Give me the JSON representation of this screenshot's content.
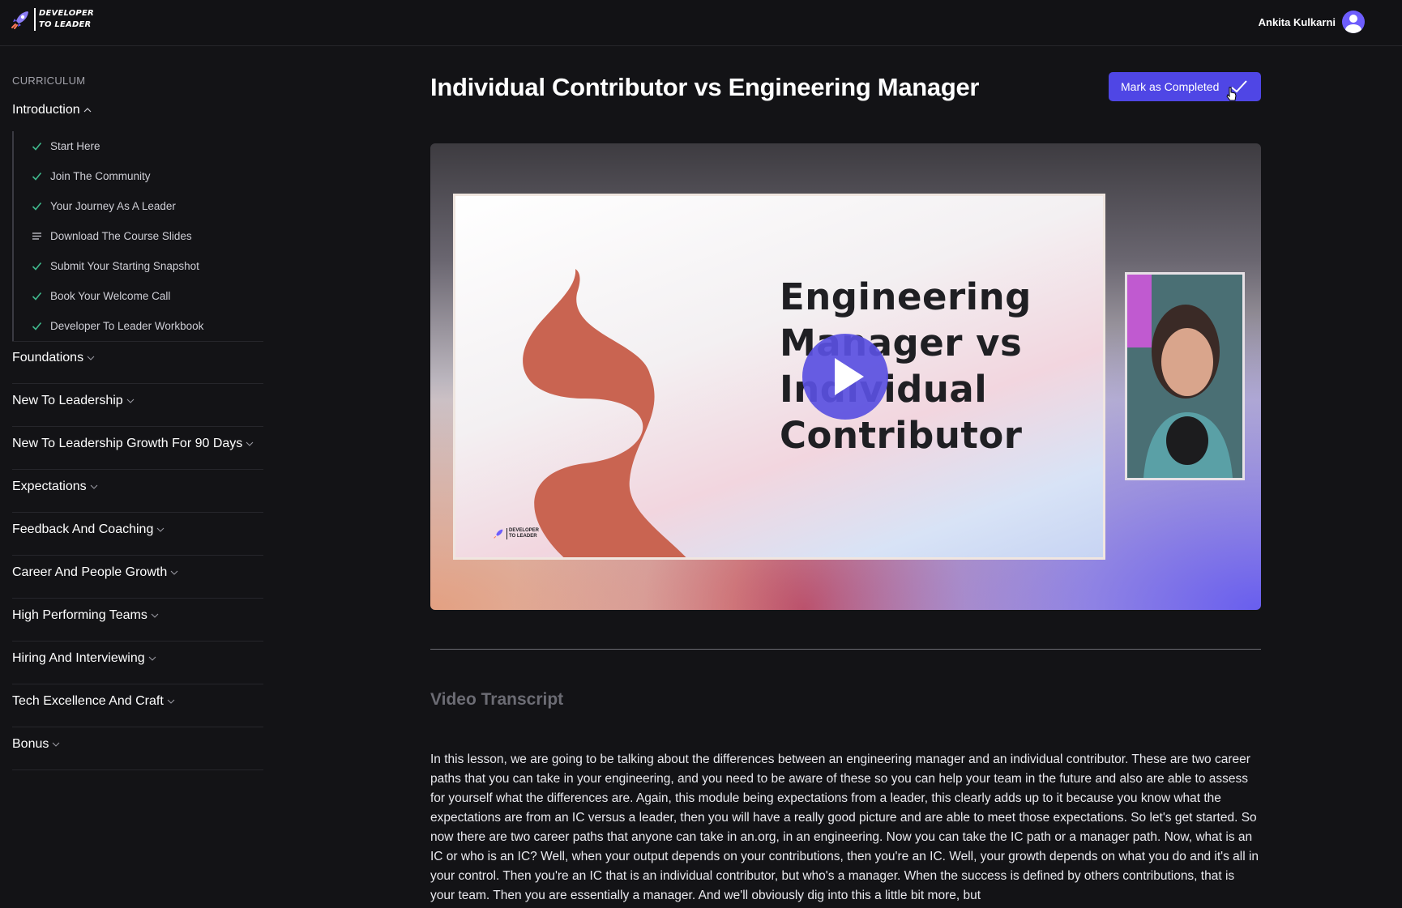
{
  "header": {
    "logo_line1": "DEVELOPER",
    "logo_line2": "TO LEADER",
    "user_name": "Ankita Kulkarni",
    "avatar_icon": "user-avatar-icon"
  },
  "sidebar": {
    "label": "CURRICULUM",
    "open_section": {
      "title": "Introduction",
      "lessons": [
        {
          "label": "Start Here",
          "icon": "check-icon"
        },
        {
          "label": "Join The Community",
          "icon": "check-icon"
        },
        {
          "label": "Your Journey As A Leader",
          "icon": "check-icon"
        },
        {
          "label": "Download The Course Slides",
          "icon": "lines-icon"
        },
        {
          "label": "Submit Your Starting Snapshot",
          "icon": "check-icon"
        },
        {
          "label": "Book Your Welcome Call",
          "icon": "check-icon"
        },
        {
          "label": "Developer To Leader Workbook",
          "icon": "check-icon"
        }
      ]
    },
    "sections": [
      "Foundations",
      "New To Leadership",
      "New To Leadership Growth For 90 Days",
      "Expectations",
      "Feedback And Coaching",
      "Career And People Growth",
      "High Performing Teams",
      "Hiring And Interviewing",
      "Tech Excellence And Craft",
      "Bonus"
    ]
  },
  "main": {
    "title": "Individual Contributor vs Engineering Manager",
    "mark_button": "Mark as Completed",
    "video": {
      "slide_title": [
        "Engineering",
        "Manager vs",
        "Individual",
        "Contributor"
      ],
      "slide_logo_line1": "DEVELOPER",
      "slide_logo_line2": "TO LEADER"
    },
    "transcript_title": "Video Transcript",
    "transcript": "In this lesson, we are going to be talking about the differences between an engineering manager and an individual contributor. These are two career paths that you can take in your engineering, and you need to be aware of these so you can help your team in the future and also are able to assess for yourself what the differences are. Again, this module being expectations from a leader, this clearly adds up to it because you know what the expectations are from an IC versus a leader, then you will have a really good picture and are able to meet those expectations. So let's get started. So now there are two career paths that anyone can take in an.org, in an engineering. Now you can take the IC path or a manager path. Now, what is an IC or who is an IC? Well, when your output depends on your contributions, then you're an IC. Well, your growth depends on what you do and it's all in your control. Then you're an IC that is an individual contributor, but who's a manager. When the success is defined by others contributions, that is your team. Then you are essentially a manager. And we'll obviously dig into this a little bit more, but"
  },
  "colors": {
    "background": "#131316",
    "accent": "#4f46e5",
    "check": "#3fb68b"
  }
}
